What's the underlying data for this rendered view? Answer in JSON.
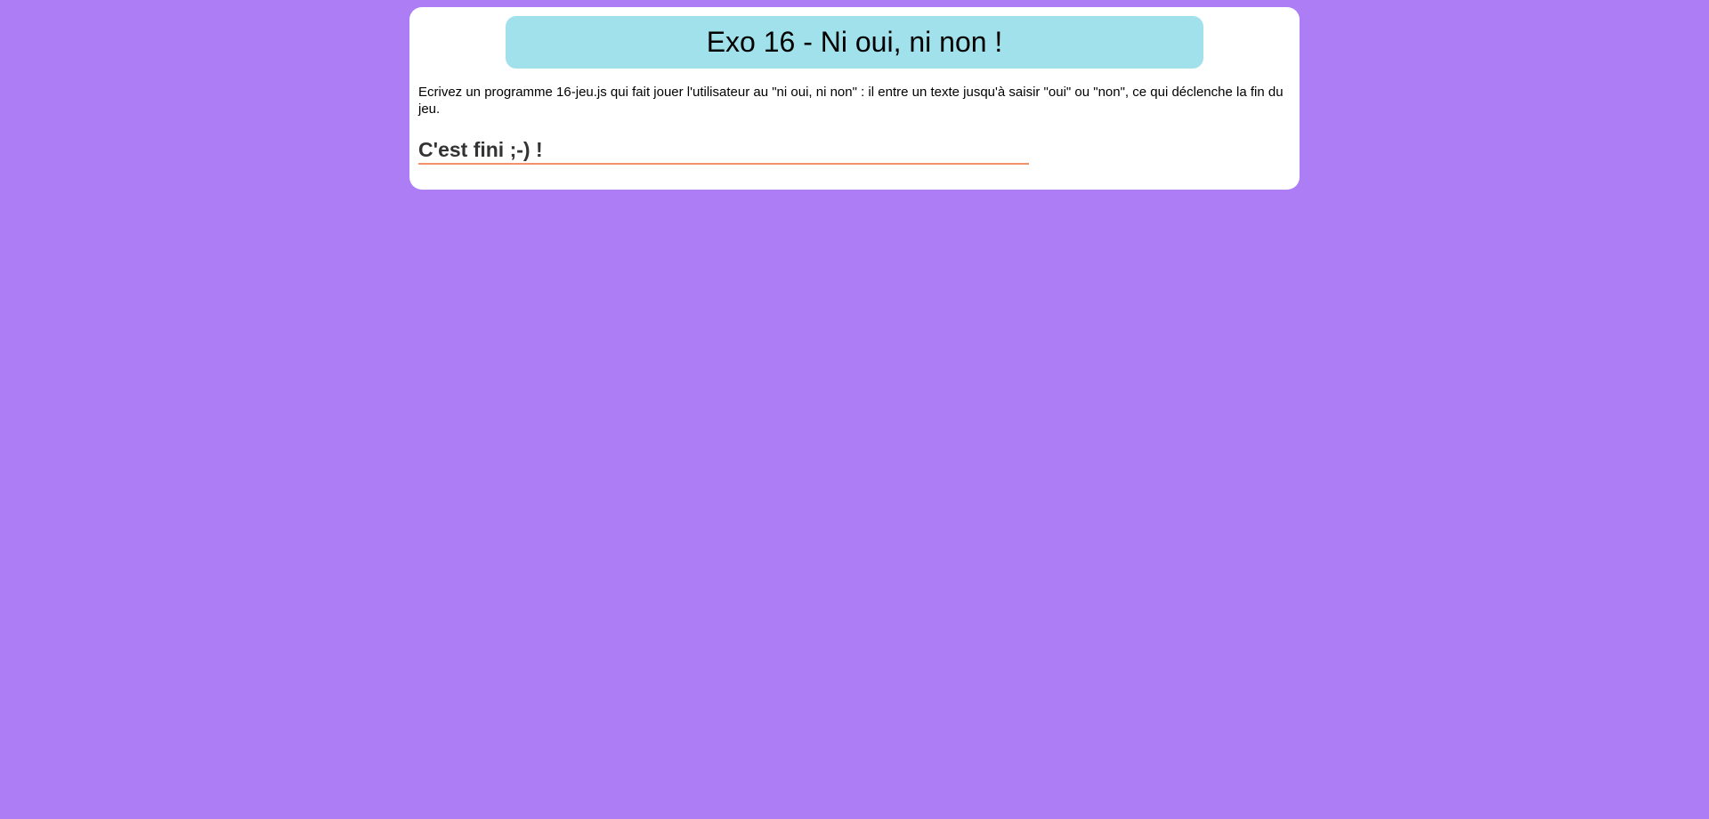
{
  "page": {
    "background_color": "#ad7df5",
    "card_color": "#ffffff"
  },
  "banner": {
    "title": "Exo 16 - Ni oui, ni non !",
    "color": "#a0e1ec"
  },
  "content": {
    "instructions": "Ecrivez un programme 16-jeu.js qui fait jouer l'utilisateur au \"ni oui, ni non\" : il entre un texte jusqu'à saisir \"oui\" ou \"non\", ce qui déclenche la fin du jeu.",
    "end_message": "C'est fini ;-) !",
    "underline_color": "#f4906a"
  }
}
